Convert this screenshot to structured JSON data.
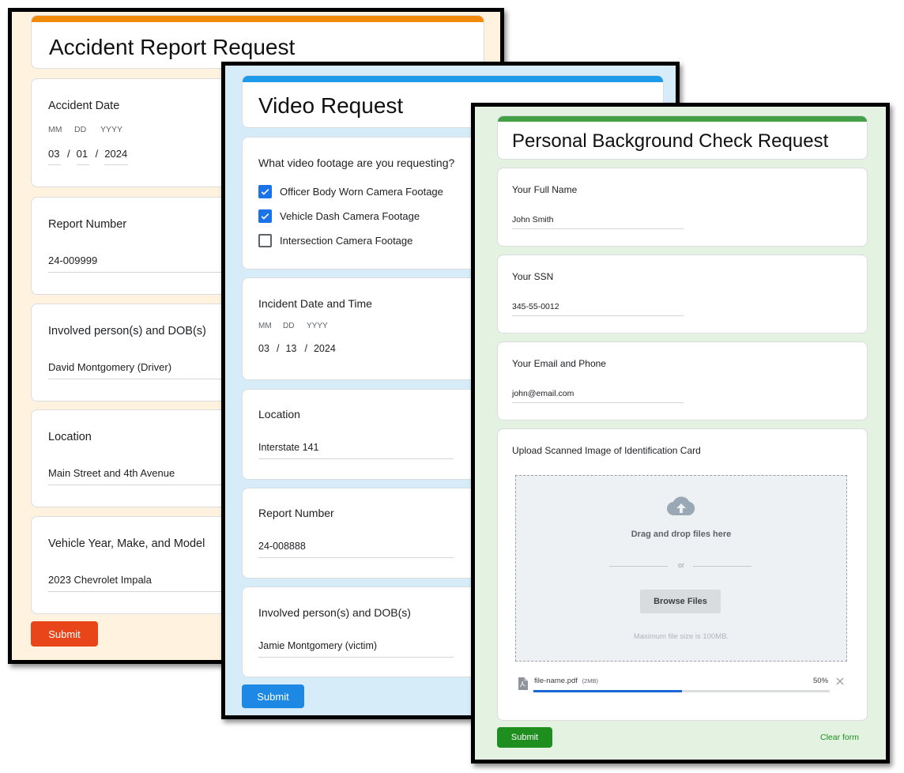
{
  "accident_form": {
    "title": "Accident Report Request",
    "accent_color": "#f28b0c",
    "background_color": "#fff2df",
    "date_question": "Accident Date",
    "date_labels": [
      "MM",
      "DD",
      "YYYY"
    ],
    "date_values": [
      "03",
      "01",
      "2024"
    ],
    "date_separator": "/",
    "report_number_label": "Report Number",
    "report_number_value": "24-009999",
    "involved_label": "Involved person(s) and DOB(s)",
    "involved_value": "David Montgomery (Driver)",
    "location_label": "Location",
    "location_value": "Main Street and 4th Avenue",
    "vehicle_label": "Vehicle Year, Make, and Model",
    "vehicle_value": "2023 Chevrolet Impala",
    "submit_label": "Submit",
    "submit_color": "#e8461a"
  },
  "video_form": {
    "title": "Video Request",
    "accent_color": "#1e9be8",
    "background_color": "#d6ecf8",
    "footage_question": "What video footage are you requesting?",
    "footage_options": [
      {
        "label": "Officer Body Worn Camera Footage",
        "checked": true
      },
      {
        "label": "Vehicle Dash Camera Footage",
        "checked": true
      },
      {
        "label": "Intersection Camera Footage",
        "checked": false
      }
    ],
    "date_question": "Incident Date and Time",
    "date_labels": [
      "MM",
      "DD",
      "YYYY"
    ],
    "date_values": [
      "03",
      "13",
      "2024"
    ],
    "date_separator": "/",
    "location_label": "Location",
    "location_value": "Interstate 141",
    "report_number_label": "Report Number",
    "report_number_value": "24-008888",
    "involved_label": "Involved person(s) and DOB(s)",
    "involved_value": "Jamie Montgomery (victim)",
    "submit_label": "Submit",
    "submit_color": "#1e88e5"
  },
  "background_form": {
    "title": "Personal Background Check Request",
    "accent_color": "#43a047",
    "background_color": "#e4f2e2",
    "name_label": "Your Full Name",
    "name_value": "John Smith",
    "ssn_label": "Your SSN",
    "ssn_value": "345-55-0012",
    "contact_label": "Your Email and Phone",
    "contact_value": "john@email.com",
    "upload_label": "Upload Scanned Image of Identification Card",
    "upload": {
      "drop_text": "Drag and drop files here",
      "or_text": "or",
      "browse_label": "Browse Files",
      "max_size_text": "Maximum file size is 100MB.",
      "icon": "cloud-upload-icon"
    },
    "file": {
      "name": "file-name.pdf",
      "size": "(2MB)",
      "progress_text": "50%",
      "progress": 0.5,
      "icon": "pdf-file-icon"
    },
    "submit_label": "Submit",
    "submit_color": "#1e8e1e",
    "clear_label": "Clear form",
    "clear_color": "#1e8e1e"
  }
}
